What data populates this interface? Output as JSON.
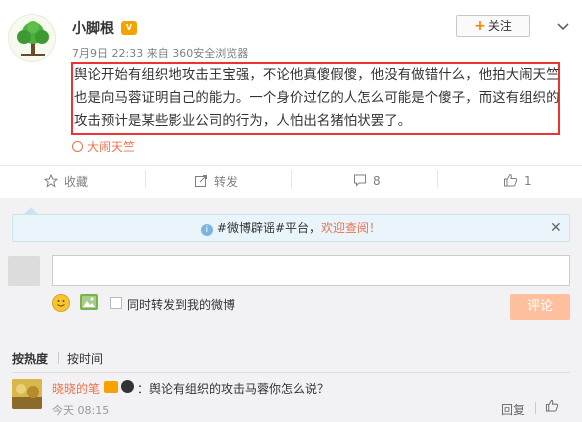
{
  "post": {
    "username": "小脚根",
    "time": "7月9日 22:33",
    "source": "来自 360安全浏览器",
    "follow_label": "关注",
    "content": "舆论开始有组织地攻击王宝强，不论他真傻假傻，他没有做错什么，他拍大闹天竺也是向马蓉证明自己的能力。一个身价过亿的人怎么可能是个傻子，而这有组织的攻击预计是某些影业公司的行为，人怕出名猪怕状罢了。",
    "location": "大闹天竺"
  },
  "actions": {
    "favorite": "收藏",
    "repost": "转发",
    "comment_count": "8",
    "like_count": "1"
  },
  "notice": {
    "prefix": "#微博辟谣#平台，",
    "highlight": "欢迎查阅！"
  },
  "composer": {
    "checkbox_label": "同时转发到我的微博",
    "submit_label": "评论"
  },
  "sort": {
    "hot": "按热度",
    "time": "按时间"
  },
  "comments": [
    {
      "name": "晓晓的笔",
      "text": "：舆论有组织的攻击马蓉你怎么说？",
      "time": "今天 08:15",
      "reply_label": "回复"
    }
  ],
  "colors": {
    "highlight_border": "#ee3333",
    "accent_orange": "#eb7350",
    "submit_disabled": "#ffc09f"
  }
}
